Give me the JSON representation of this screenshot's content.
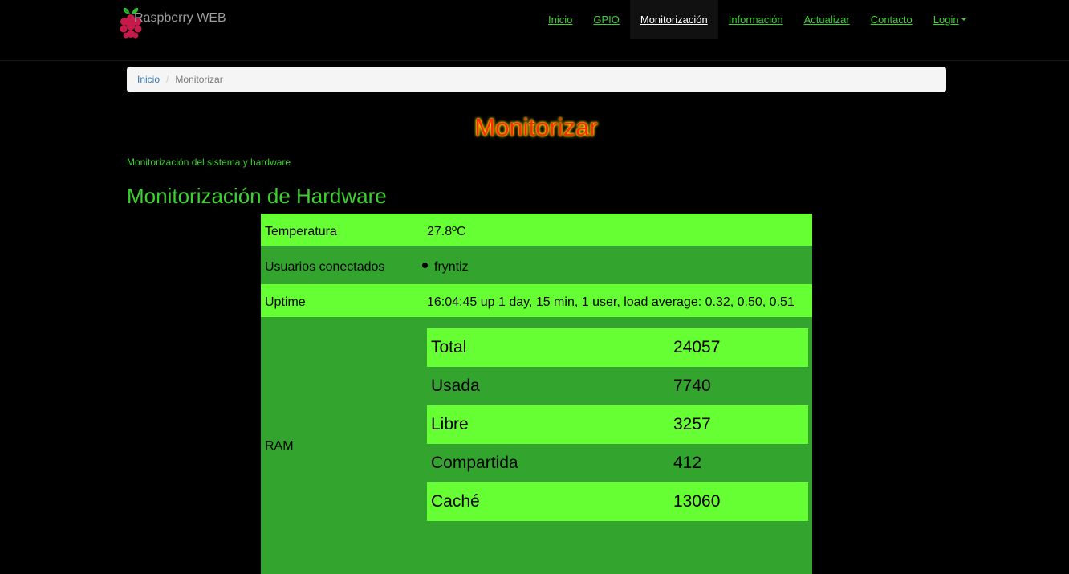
{
  "navbar": {
    "brand": "Raspberry WEB",
    "items": [
      {
        "label": "Inicio"
      },
      {
        "label": "GPIO"
      },
      {
        "label": "Monitorización",
        "active": true
      },
      {
        "label": "Información"
      },
      {
        "label": "Actualizar"
      },
      {
        "label": "Contacto"
      },
      {
        "label": "Login"
      }
    ]
  },
  "breadcrumb": {
    "home": "Inicio",
    "current": "Monitorizar"
  },
  "page": {
    "title": "Monitorizar",
    "subtitle": "Monitorización del sistema y hardware",
    "section_title": "Monitorización de Hardware"
  },
  "hardware": {
    "temperature_label": "Temperatura",
    "temperature_value": "27.8ºC",
    "users_label": "Usuarios conectados",
    "users": [
      "fryntiz"
    ],
    "uptime_label": "Uptime",
    "uptime_value": "16:04:45 up 1 day, 15 min, 1 user, load average: 0.32, 0.50, 0.51",
    "ram_label": "RAM",
    "ram": [
      {
        "name": "Total",
        "value": "24057"
      },
      {
        "name": "Usada",
        "value": "7740"
      },
      {
        "name": "Libre",
        "value": "3257"
      },
      {
        "name": "Compartida",
        "value": "412"
      },
      {
        "name": "Caché",
        "value": "13060"
      }
    ]
  },
  "colors": {
    "nav_link": "#3cd12f",
    "row_light": "#66ff33",
    "row_dark": "#33a52f",
    "title": "#ff2a00",
    "title_glow": "#ffe600"
  },
  "icons": {
    "logo": "raspberry-pi-logo-icon",
    "dropdown": "caret-down-icon",
    "list_bullet": "bullet-icon"
  }
}
